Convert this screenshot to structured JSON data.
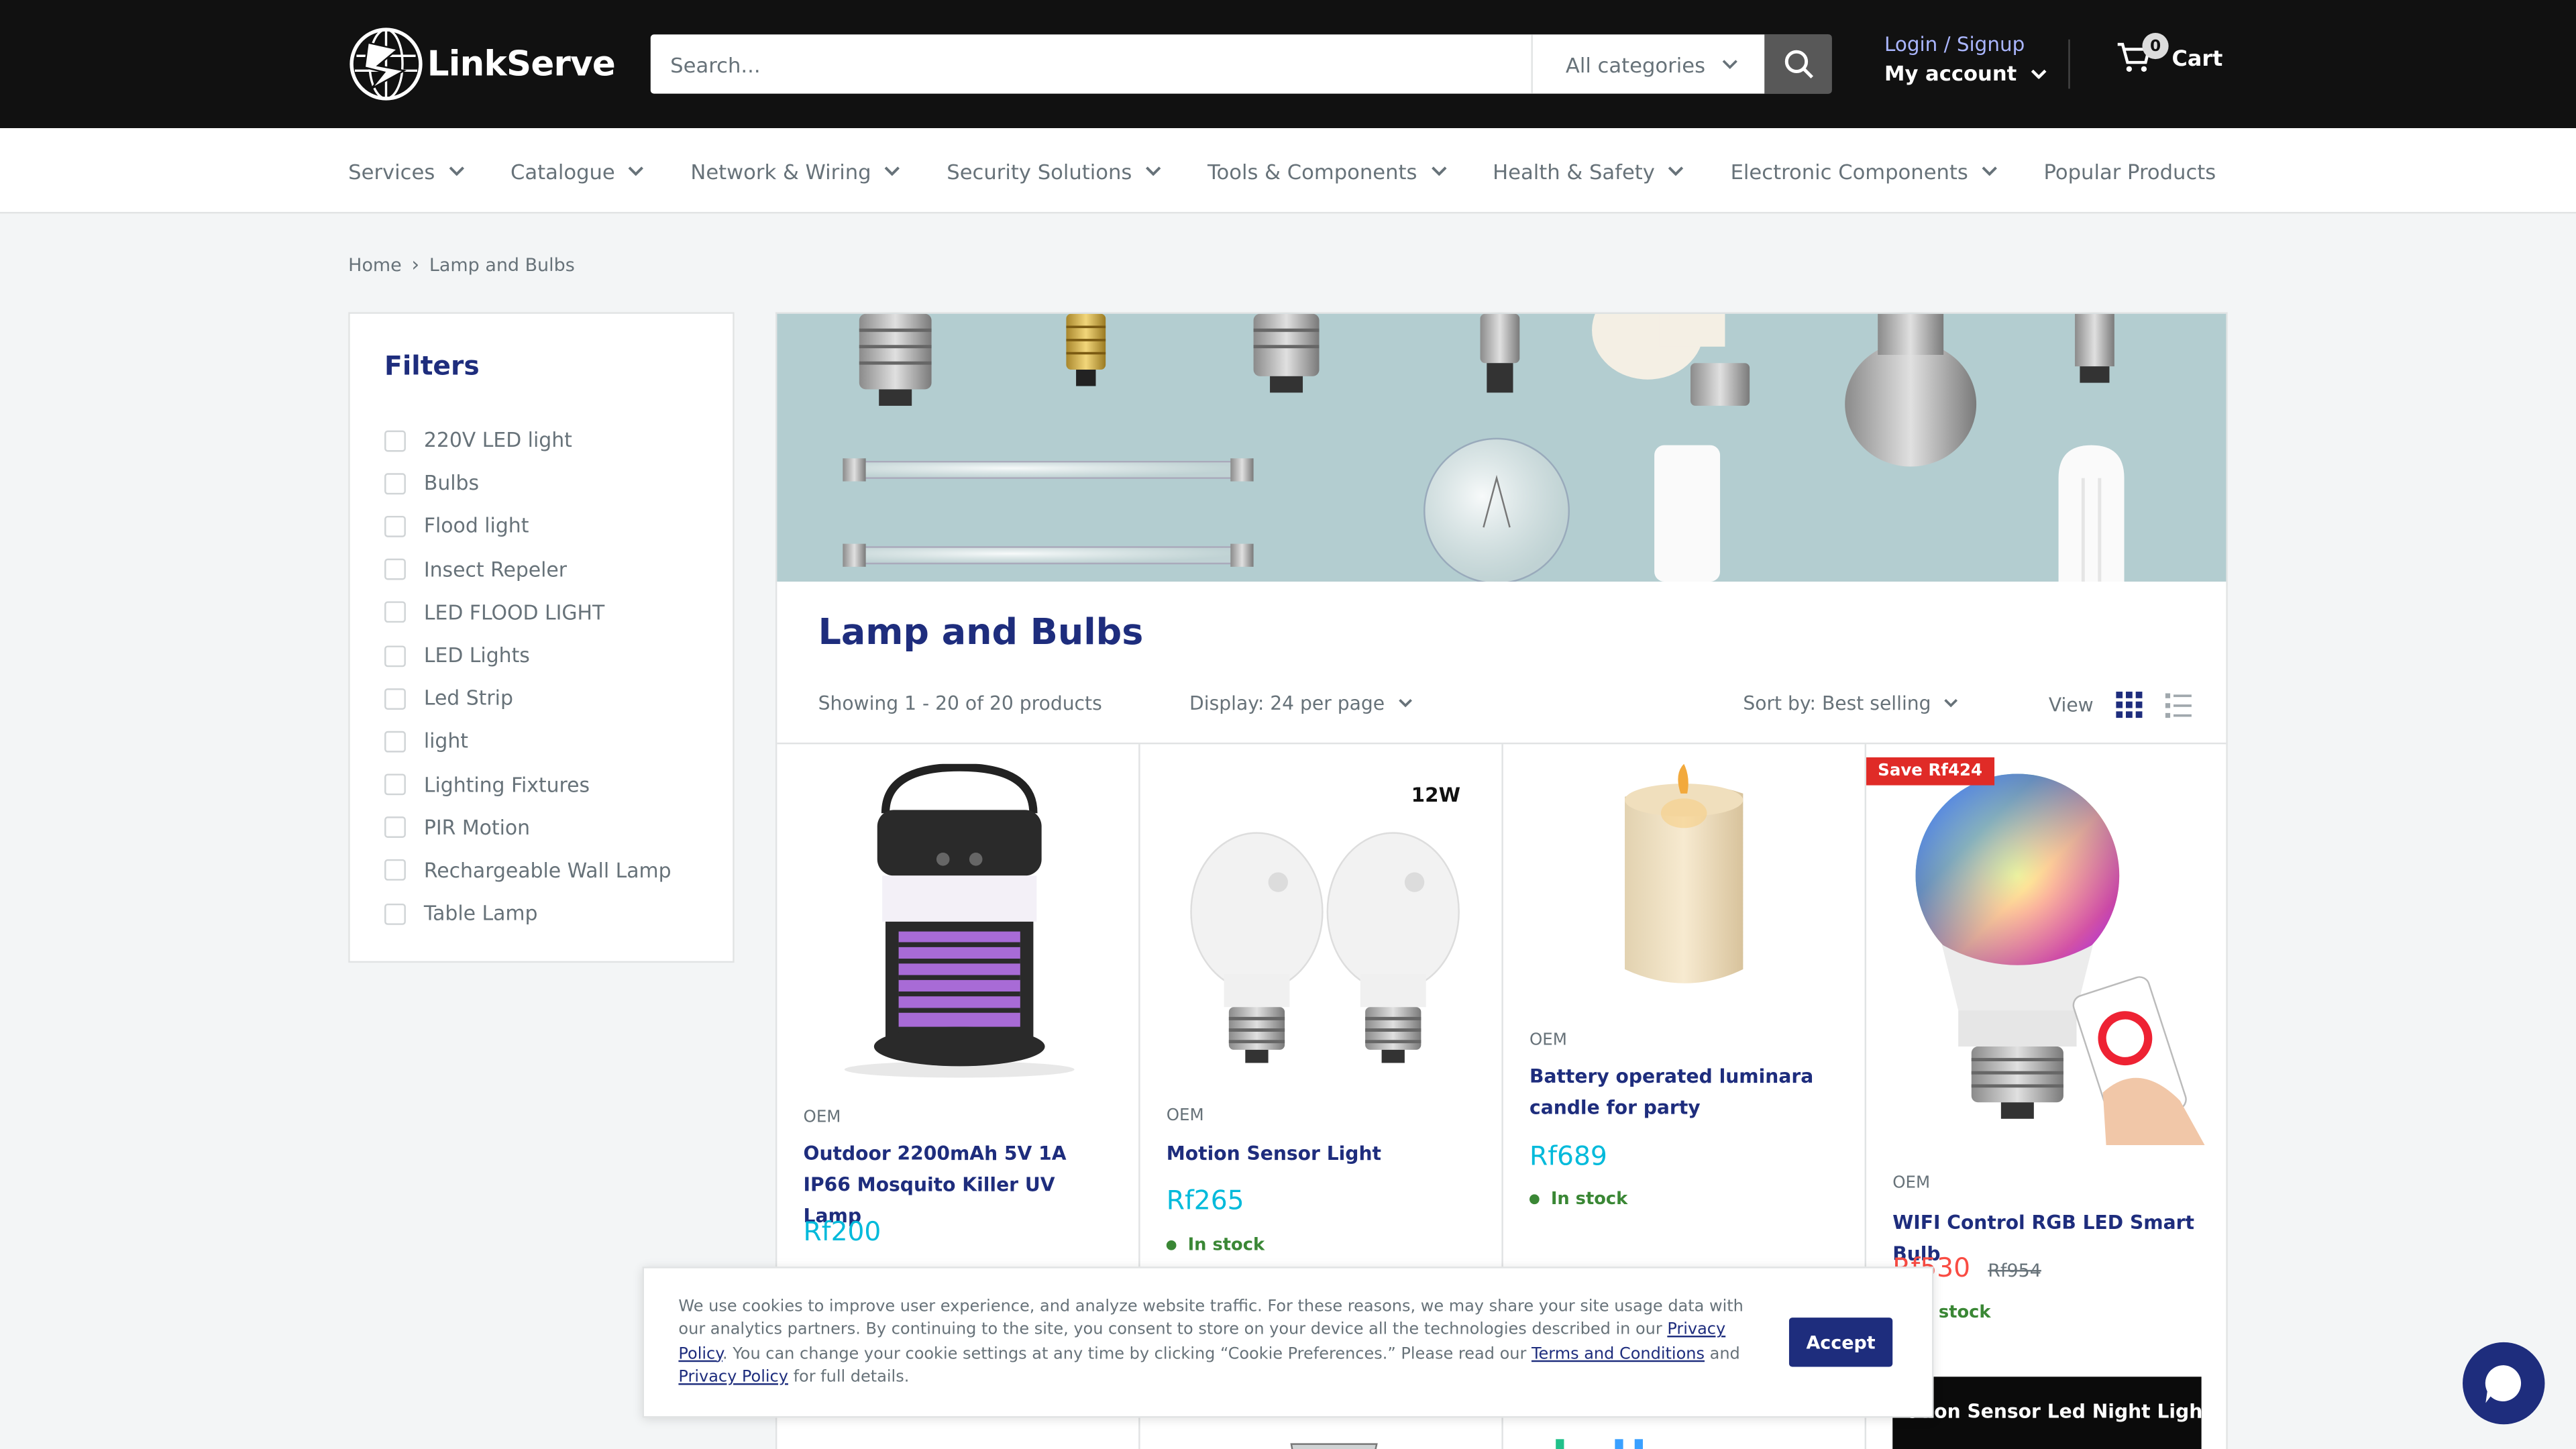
{
  "header": {
    "logo_text": "LinkServe",
    "search": {
      "placeholder": "Search...",
      "category": "All categories"
    },
    "account": {
      "login_label": "Login / Signup",
      "my_account_label": "My account"
    },
    "cart": {
      "label": "Cart",
      "count": "0"
    }
  },
  "nav": {
    "items": [
      {
        "label": "Services",
        "has_dropdown": true
      },
      {
        "label": "Catalogue",
        "has_dropdown": true
      },
      {
        "label": "Network & Wiring",
        "has_dropdown": true
      },
      {
        "label": "Security Solutions",
        "has_dropdown": true
      },
      {
        "label": "Tools & Components",
        "has_dropdown": true
      },
      {
        "label": "Health & Safety",
        "has_dropdown": true
      },
      {
        "label": "Electronic Components",
        "has_dropdown": true
      },
      {
        "label": "Popular Products",
        "has_dropdown": false
      }
    ]
  },
  "breadcrumb": {
    "home": "Home",
    "separator": "›",
    "current": "Lamp and Bulbs"
  },
  "filters": {
    "title": "Filters",
    "items": [
      "220V LED light",
      "Bulbs",
      "Flood light",
      "Insect Repeler",
      "LED FLOOD LIGHT",
      "LED Lights",
      "Led Strip",
      "light",
      "Lighting Fixtures",
      "PIR Motion",
      "Rechargeable Wall Lamp",
      "Table Lamp"
    ]
  },
  "collection": {
    "title": "Lamp and Bulbs",
    "showing": "Showing 1 - 20 of 20 products",
    "display": "Display: 24 per page",
    "sort": "Sort by: Best selling",
    "view_label": "View"
  },
  "products": [
    {
      "vendor": "OEM",
      "title": "Outdoor 2200mAh 5V 1A IP66 Mosquito Killer UV Lamp",
      "price": "Rf200",
      "stock": "",
      "badge": "",
      "compare_price": ""
    },
    {
      "vendor": "OEM",
      "title": "Motion Sensor Light",
      "price": "Rf265",
      "stock": "In stock",
      "badge": "",
      "compare_price": "",
      "image_text": "12W"
    },
    {
      "vendor": "OEM",
      "title": "Battery operated luminara candle for party",
      "price": "Rf689",
      "stock": "In stock",
      "badge": "",
      "compare_price": ""
    },
    {
      "vendor": "OEM",
      "title": "WIFI Control RGB LED Smart Bulb",
      "price": "Rf530",
      "stock": "In stock",
      "badge": "Save Rf424",
      "compare_price": "Rf954"
    }
  ],
  "next_row": {
    "partial_title": "otion Sensor Led Night Light"
  },
  "cookie": {
    "text_1": "We use cookies to improve user experience, and analyze website traffic. For these reasons, we may share your site usage data with our analytics partners. By continuing to the site, you consent to store on your device all the technologies described in our ",
    "link_privacy": "Privacy Policy",
    "text_2": ". You can change your cookie settings at any time by clicking “Cookie Preferences.” Please read our ",
    "link_terms": "Terms and Conditions",
    "text_3": " and ",
    "text_4": " for full details.",
    "accept": "Accept"
  },
  "colors": {
    "brand_navy": "#1e2d7d",
    "price_cyan": "#00badb",
    "sale_red": "#e02b27",
    "stock_green": "#3a8735",
    "header_bg": "#111111"
  }
}
